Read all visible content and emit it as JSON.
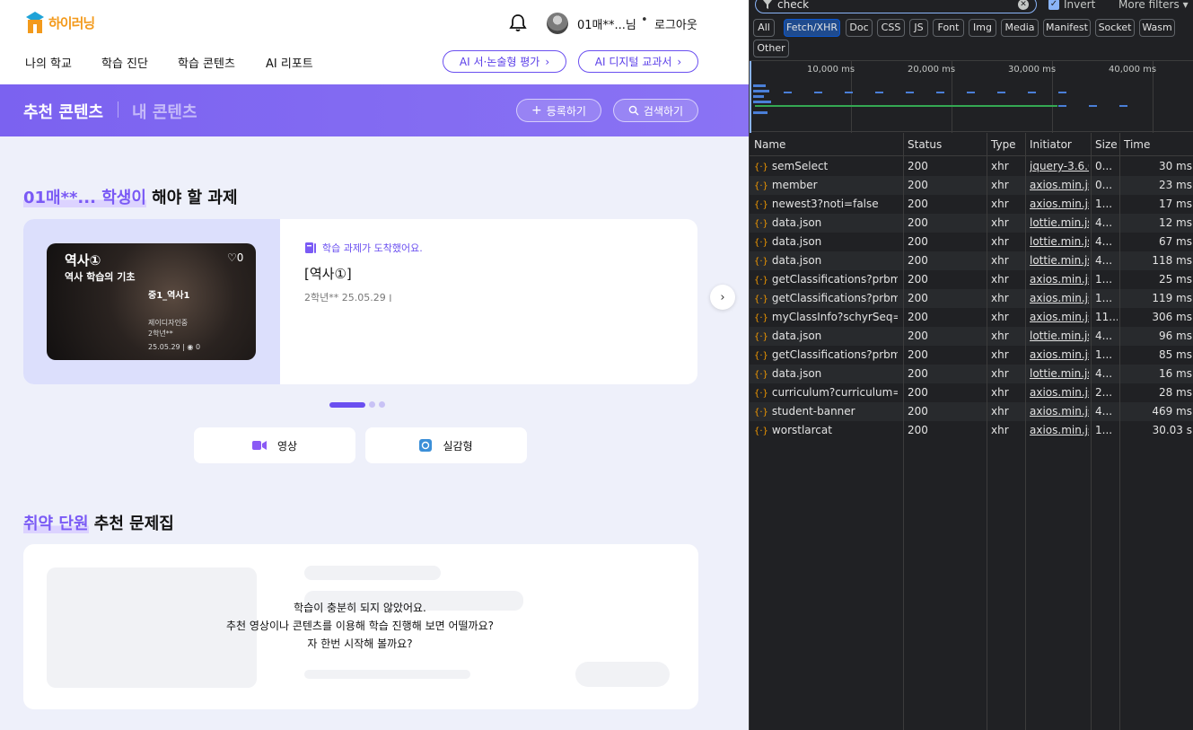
{
  "site": {
    "logo_text": "하이러닝",
    "user": {
      "name": "01매**...님",
      "separator": "•",
      "logout": "로그아웃"
    },
    "nav": [
      "나의 학교",
      "학습 진단",
      "학습 콘텐츠",
      "AI 리포트"
    ],
    "pills": [
      "AI 서·논술형 평가",
      "AI 디지털 교과서"
    ],
    "band": {
      "active_tab": "추천 콘텐츠",
      "inactive_tab": "내 콘텐츠",
      "register": "등록하기",
      "search": "검색하기"
    },
    "task_section": {
      "title_highlight": "01매**... 학생이",
      "title_rest": " 해야 할 과제"
    },
    "task_card": {
      "thumb": {
        "subject": "역사①",
        "subtitle": "역사 학습의 기초",
        "likes": "0",
        "course": "중1_역사1",
        "publisher": "제이디자인중",
        "grade": "2학년**",
        "date_views": "25.05.29 | ",
        "views": "0"
      },
      "note": "학습 과제가 도착했어요.",
      "title": "[역사①]",
      "meta": "2학년** ׀ 25.05.29"
    },
    "carousel_dots": {
      "active": 1,
      "total": 3
    },
    "category_buttons": [
      "영상",
      "실감형"
    ],
    "weak_section": {
      "title_highlight": "취약 단원",
      "title_rest": " 추천 문제집"
    },
    "empty_message": [
      "학습이 충분히 되지 않았어요.",
      "추천 영상이나 콘텐츠를 이용해 학습 진행해 보면 어떨까요?",
      "자 한번 시작해 볼까요?"
    ]
  },
  "devtools": {
    "filter_value": "check",
    "invert_label": "Invert",
    "more_filters": "More filters",
    "chips": [
      "All",
      "Fetch/XHR",
      "Doc",
      "CSS",
      "JS",
      "Font",
      "Img",
      "Media",
      "Manifest",
      "Socket",
      "Wasm",
      "Other"
    ],
    "selected_chip": "Fetch/XHR",
    "timeline_ticks": [
      "10,000 ms",
      "20,000 ms",
      "30,000 ms",
      "40,000 ms"
    ],
    "columns": [
      "Name",
      "Status",
      "Type",
      "Initiator",
      "Size",
      "Time"
    ],
    "rows": [
      {
        "name": "semSelect",
        "status": "200",
        "type": "xhr",
        "initiator": "jquery-3.6.0.",
        "size": "0...",
        "time": "30 ms"
      },
      {
        "name": "member",
        "status": "200",
        "type": "xhr",
        "initiator": "axios.min.js:2",
        "size": "0...",
        "time": "23 ms"
      },
      {
        "name": "newest3?noti=false",
        "status": "200",
        "type": "xhr",
        "initiator": "axios.min.js:2",
        "size": "1...",
        "time": "17 ms"
      },
      {
        "name": "data.json",
        "status": "200",
        "type": "xhr",
        "initiator": "lottie.min.js:1",
        "size": "4...",
        "time": "12 ms"
      },
      {
        "name": "data.json",
        "status": "200",
        "type": "xhr",
        "initiator": "lottie.min.js:1",
        "size": "4...",
        "time": "67 ms"
      },
      {
        "name": "data.json",
        "status": "200",
        "type": "xhr",
        "initiator": "lottie.min.js:1",
        "size": "4...",
        "time": "118 ms"
      },
      {
        "name": "getClassifications?prbm...",
        "status": "200",
        "type": "xhr",
        "initiator": "axios.min.js:2",
        "size": "1...",
        "time": "25 ms"
      },
      {
        "name": "getClassifications?prbm...",
        "status": "200",
        "type": "xhr",
        "initiator": "axios.min.js:2",
        "size": "1...",
        "time": "119 ms"
      },
      {
        "name": "myClassInfo?schyrSeq=6...",
        "status": "200",
        "type": "xhr",
        "initiator": "axios.min.js:2",
        "size": "11...",
        "time": "306 ms"
      },
      {
        "name": "data.json",
        "status": "200",
        "type": "xhr",
        "initiator": "lottie.min.js:1",
        "size": "4...",
        "time": "96 ms"
      },
      {
        "name": "getClassifications?prbm...",
        "status": "200",
        "type": "xhr",
        "initiator": "axios.min.js:2",
        "size": "1...",
        "time": "85 ms"
      },
      {
        "name": "data.json",
        "status": "200",
        "type": "xhr",
        "initiator": "lottie.min.js:1",
        "size": "4...",
        "time": "16 ms"
      },
      {
        "name": "curriculum?curriculum=J...",
        "status": "200",
        "type": "xhr",
        "initiator": "axios.min.js:2",
        "size": "2...",
        "time": "28 ms"
      },
      {
        "name": "student-banner",
        "status": "200",
        "type": "xhr",
        "initiator": "axios.min.js:2",
        "size": "4...",
        "time": "469 ms"
      },
      {
        "name": "worstlarcat",
        "status": "200",
        "type": "xhr",
        "initiator": "axios.min.js:2",
        "size": "1...",
        "time": "30.03 s"
      }
    ]
  }
}
